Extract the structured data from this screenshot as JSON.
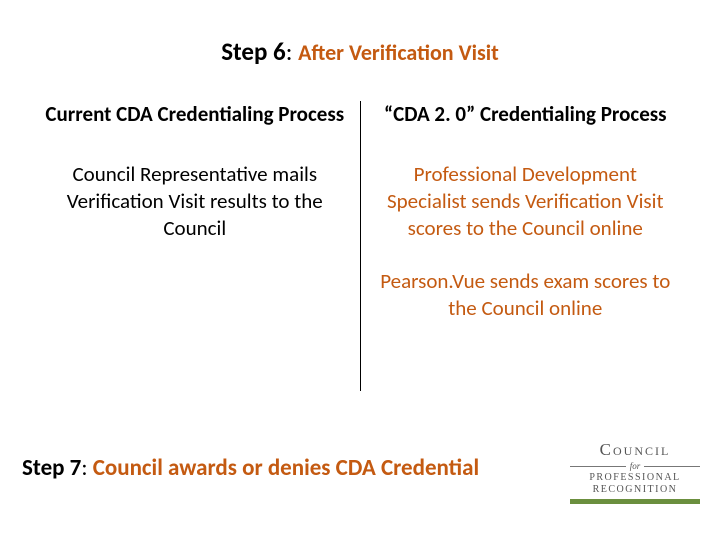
{
  "title": {
    "step": "Step 6",
    "colon": ": ",
    "sub": "After Verification Visit"
  },
  "left": {
    "heading": "Current CDA Credentialing Process",
    "body1": "Council Representative mails Verification Visit results to the Council"
  },
  "right": {
    "heading": "“CDA 2. 0” Credentialing Process",
    "body1": "Professional Development Specialist sends Verification Visit scores to the Council online",
    "body2": "Pearson.Vue sends exam scores to the Council online"
  },
  "step7": {
    "step": "Step 7",
    "colon": ": ",
    "text": "Council awards or denies CDA Credential"
  },
  "logo": {
    "council": "Council",
    "for": "for",
    "line1": "PROFESSIONAL",
    "line2": "RECOGNITION"
  }
}
